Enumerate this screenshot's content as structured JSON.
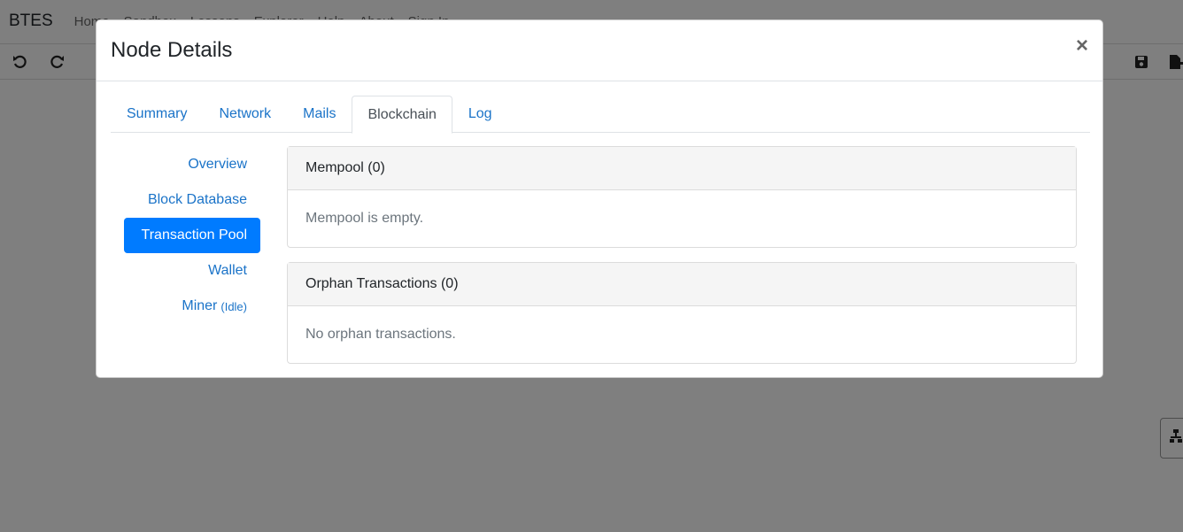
{
  "app": {
    "brand": "BTES",
    "nav": [
      "Home",
      "Sandbox",
      "Lessons",
      "Explorer",
      "Help",
      "About",
      "Sign In"
    ]
  },
  "toolbar": {
    "undo_icon": "undo-icon",
    "redo_icon": "redo-icon",
    "save_icon": "save-icon",
    "export_icon": "export-icon"
  },
  "modal": {
    "title": "Node Details",
    "close_label": "×",
    "tabs": [
      {
        "label": "Summary",
        "active": false
      },
      {
        "label": "Network",
        "active": false
      },
      {
        "label": "Mails",
        "active": false
      },
      {
        "label": "Blockchain",
        "active": true
      },
      {
        "label": "Log",
        "active": false
      }
    ],
    "sidebar": [
      {
        "label": "Overview",
        "active": false
      },
      {
        "label": "Block Database",
        "active": false
      },
      {
        "label": "Transaction Pool",
        "active": true
      },
      {
        "label": "Wallet",
        "active": false
      },
      {
        "label": "Miner",
        "status": "(Idle)",
        "active": false
      }
    ],
    "mempool": {
      "header": "Mempool (0)",
      "body": "Mempool is empty."
    },
    "orphans": {
      "header": "Orphan Transactions (0)",
      "body": "No orphan transactions."
    }
  },
  "colors": {
    "accent": "#007bff",
    "link": "#1a73c8",
    "backdrop": "rgba(0,0,0,0.5)"
  }
}
